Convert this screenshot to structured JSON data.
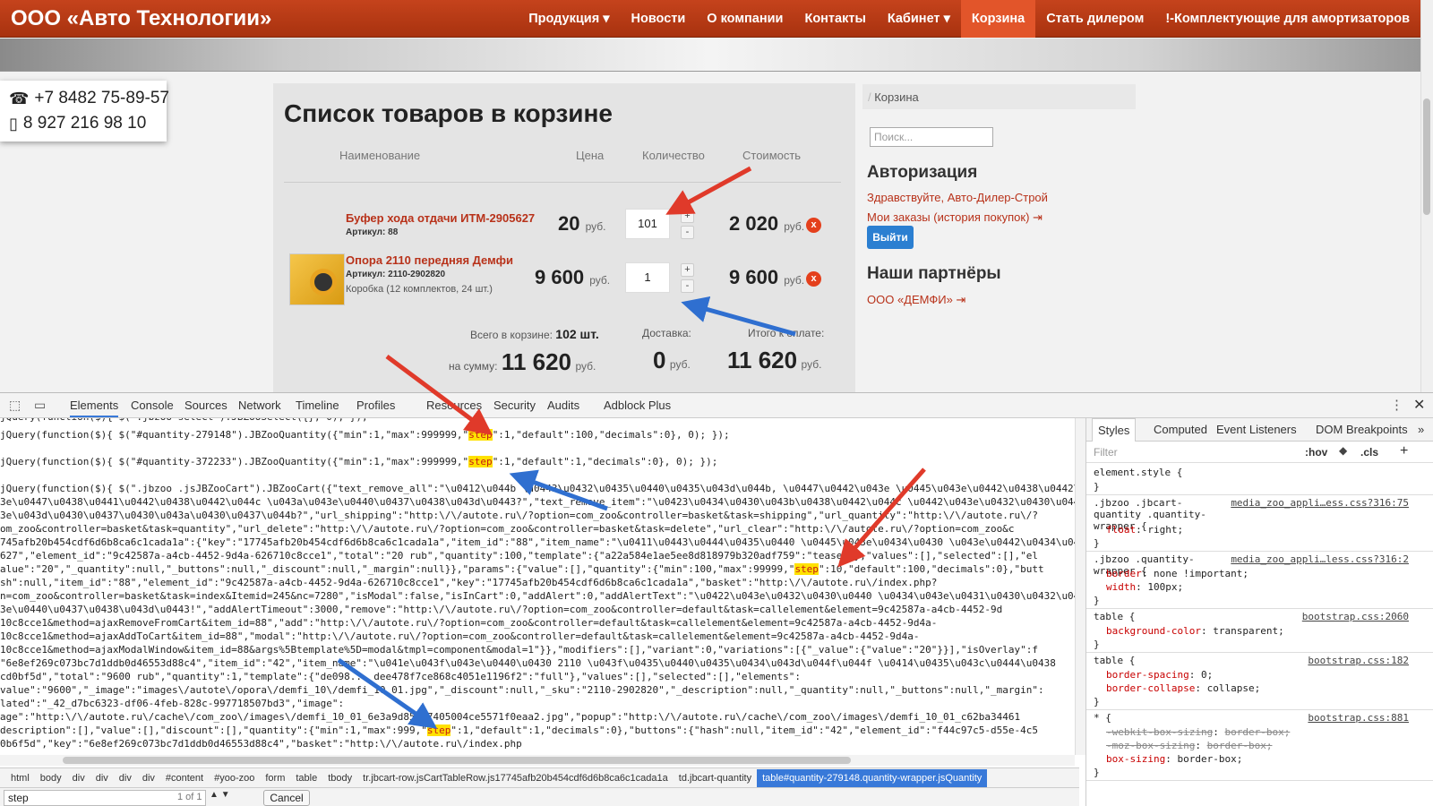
{
  "site": {
    "brand": "ООО «Авто Технологии»",
    "nav": [
      {
        "label": "Продукция",
        "caret": true
      },
      {
        "label": "Новости"
      },
      {
        "label": "О компании"
      },
      {
        "label": "Контакты"
      },
      {
        "label": "Кабинет",
        "caret": true
      },
      {
        "label": "Корзина",
        "active": true
      },
      {
        "label": "Стать дилером"
      },
      {
        "label": "!-Комплектующие для амортизаторов"
      }
    ],
    "phones": [
      "+7 8482 75-89-57",
      "8 927 216 98 10"
    ]
  },
  "cart": {
    "title": "Список товаров в корзине",
    "headers": {
      "name": "Наименование",
      "price": "Цена",
      "qty": "Количество",
      "cost": "Стоимость"
    },
    "items": [
      {
        "name": "Буфер хода отдачи ИТМ-2905627",
        "article": "Артикул: 88",
        "box": "",
        "price": "20",
        "qty": "101",
        "cost": "2 020"
      },
      {
        "name": "Опора 2110 передняя Демфи",
        "article": "Артикул: 2110-2902820",
        "box": "Коробка (12 комплектов, 24 шт.)",
        "price": "9 600",
        "qty": "1",
        "cost": "9 600"
      }
    ],
    "currency": "руб.",
    "total_count_label": "Всего в корзине:",
    "total_count": "102 шт.",
    "sum_label": "на сумму:",
    "sum": "11 620",
    "delivery_label": "Доставка:",
    "delivery": "0",
    "pay_label": "Итого к оплате:",
    "pay": "11 620",
    "plus": "+",
    "minus": "-",
    "remove": "x"
  },
  "sidebar": {
    "breadcrumb": "Корзина",
    "search_placeholder": "Поиск...",
    "auth_title": "Авторизация",
    "greeting": "Здравствуйте, Авто-Дилер-Строй",
    "orders_link": "Мои заказы (история покупок)",
    "logout": "Выйти",
    "partners_title": "Наши партнёры",
    "partner": "ООО «ДЕМФИ»"
  },
  "devtools": {
    "tabs": [
      "Elements",
      "Console",
      "Sources",
      "Network",
      "Timeline",
      "Profiles",
      "Resources",
      "Security",
      "Audits",
      "Adblock Plus"
    ],
    "code_lines": [
      {
        "pre": "jQuery(function($){ $(\".jbzoo-select\").JBZooSelect({}, 0); });",
        "hl": "",
        "post": ""
      },
      {
        "pre": "jQuery(function($){ $(\"#quantity-279148\").JBZooQuantity({\"min\":1,\"max\":999999,\"",
        "hl": "step",
        "post": "\":1,\"default\":100,\"decimals\":0}, 0); });"
      },
      {
        "pre": "jQuery(function($){ $(\"#quantity-372233\").JBZooQuantity({\"min\":1,\"max\":999999,\"",
        "hl": "step",
        "post": "\":1,\"default\":1,\"decimals\":0}, 0); });"
      },
      {
        "pre": "jQuery(function($){ $(\".jbzoo .jsJBZooCart\").JBZooCart({\"text_remove_all\":\"\\u0412\\u044b \\u0443\\u0432\\u0435\\u0440\\u0435\\u043d\\u044b, \\u0447\\u0442\\u043e \\u0445\\u043e\\u0442\\u0438\\u0442\\u0435 \\u043e\\u0447\\u0438\\u0441\\u0442\\u0438\\u0442\\u044c \\u043a\\u043e\\u0440\\u0437\\u0438\\u043d\\u0443",
        "hl": "",
        "post": ""
      },
      {
        "pre": "3e\\u0447\\u0438\\u0441\\u0442\\u0438\\u0442\\u044c \\u043a\\u043e\\u0440\\u0437\\u0438\\u043d\\u0443?\",\"text_remove_item\":\"\\u0423\\u0434\\u0430\\u043b\\u0438\\u0442\\u044c \\u0442\\u043e\\u0432\\u0430\\u0440?\"",
        "hl": "",
        "post": ""
      },
      {
        "pre": "3e\\u043d\\u0430\\u0437\\u0430\\u043a\\u0430\\u0437\\u044b?\",\"url_shipping\":\"http:\\/\\/autote.ru\\/?option=com_zoo&controller=basket&task=shipping\",\"url_quantity\":\"http:\\/\\/autote.ru\\/?",
        "hl": "",
        "post": ""
      },
      {
        "pre": "om_zoo&controller=basket&task=quantity\",\"url_delete\":\"http:\\/\\/autote.ru\\/?option=com_zoo&controller=basket&task=delete\",\"url_clear\":\"http:\\/\\/autote.ru\\/?option=com_zoo&c",
        "hl": "",
        "post": ""
      },
      {
        "pre": "745afb20b454cdf6d6b8ca6c1cada1a\":{\"key\":\"17745afb20b454cdf6d6b8ca6c1cada1a\",\"item_id\":\"88\",\"item_name\":\"\\u0411\\u0443\\u0444\\u0435\\u0440 \\u0445\\u043e\\u0434\\u0430 \\u043e\\u0442\\u0434\\u0430",
        "hl": "",
        "post": ""
      },
      {
        "pre": "627\",\"element_id\":\"9c42587a-a4cb-4452-9d4a-626710c8cce1\",\"total\":\"20 rub\",\"quantity\":100,\"template\":{\"a22a584e1ae5ee8d818979b320adf759\":\"teaser\"},\"values\":[],\"selected\":[],\"el",
        "hl": "",
        "post": ""
      },
      {
        "pre": "alue\":\"20\",\"_quantity\":null,\"_buttons\":null,\"_discount\":null,\"_margin\":null}},\"params\":{\"value\":[],\"quantity\":{\"min\":100,\"max\":99999,\"",
        "hl": "step",
        "post": "\":10,\"default\":100,\"decimals\":0},\"butt"
      },
      {
        "pre": "sh\":null,\"item_id\":\"88\",\"element_id\":\"9c42587a-a4cb-4452-9d4a-626710c8cce1\",\"key\":\"17745afb20b454cdf6d6b8ca6c1cada1a\",\"basket\":\"http:\\/\\/autote.ru\\/index.php?",
        "hl": "",
        "post": ""
      },
      {
        "pre": "n=com_zoo&controller=basket&task=index&Itemid=245&nc=7280\",\"isModal\":false,\"isInCart\":0,\"addAlert\":0,\"addAlertText\":\"\\u0422\\u043e\\u0432\\u0430\\u0440 \\u0434\\u043e\\u0431\\u0430\\u0432\\u043b\\u0435\\u043d \\u0432 \\u043a",
        "hl": "",
        "post": ""
      },
      {
        "pre": "3e\\u0440\\u0437\\u0438\\u043d\\u0443!\",\"addAlertTimeout\":3000,\"remove\":\"http:\\/\\/autote.ru\\/?option=com_zoo&controller=default&task=callelement&element=9c42587a-a4cb-4452-9d",
        "hl": "",
        "post": ""
      },
      {
        "pre": "10c8cce1&method=ajaxRemoveFromCart&item_id=88\",\"add\":\"http:\\/\\/autote.ru\\/?option=com_zoo&controller=default&task=callelement&element=9c42587a-a4cb-4452-9d4a-",
        "hl": "",
        "post": ""
      },
      {
        "pre": "10c8cce1&method=ajaxAddToCart&item_id=88\",\"modal\":\"http:\\/\\/autote.ru\\/?option=com_zoo&controller=default&task=callelement&element=9c42587a-a4cb-4452-9d4a-",
        "hl": "",
        "post": ""
      },
      {
        "pre": "10c8cce1&method=ajaxModalWindow&item_id=88&args%5Btemplate%5D=modal&tmpl=component&modal=1\"}},\"modifiers\":[],\"variant\":0,\"variations\":[{\"_value\":{\"value\":\"20\"}}],\"isOverlay\":f",
        "hl": "",
        "post": ""
      },
      {
        "pre": "\"6e8ef269c073bc7d1ddb0d46553d88c4\",\"item_id\":\"42\",\"item_name\":\"\\u041e\\u043f\\u043e\\u0440\\u0430 2110 \\u043f\\u0435\\u0440\\u0435\\u0434\\u043d\\u044f\\u044f \\u0414\\u0435\\u043c\\u0444\\u0438",
        "hl": "",
        "post": ""
      },
      {
        "pre": "cd0bf5d\",\"total\":\"9600 rub\",\"quantity\":1,\"template\":{\"de098... dee478f7ce868c4051e1196f2\":\"full\"},\"values\":[],\"selected\":[],\"elements\":",
        "hl": "",
        "post": ""
      },
      {
        "pre": "value\":\"9600\",\"_image\":\"images\\/autote\\/opora\\/demfi_10\\/demfi_10_01.jpg\",\"_discount\":null,\"_sku\":\"2110-2902820\",\"_description\":null,\"_quantity\":null,\"_buttons\":null,\"_margin\":",
        "hl": "",
        "post": ""
      },
      {
        "pre": "lated\":\"_42_d7bc6323-df06-4feb-828c-997718507bd3\",\"image\":",
        "hl": "",
        "post": ""
      },
      {
        "pre": "age\":\"http:\\/\\/autote.ru\\/cache\\/com_zoo\\/images\\/demfi_10_01_6e3a9d85ad7405004ce5571f0eaa2.jpg\",\"popup\":\"http:\\/\\/autote.ru\\/cache\\/com_zoo\\/images\\/demfi_10_01_c62ba34461",
        "hl": "",
        "post": ""
      },
      {
        "pre": "description\":[],\"value\":[],\"discount\":[],\"quantity\":{\"min\":1,\"max\":999,\"",
        "hl": "step",
        "post": "\":1,\"default\":1,\"decimals\":0},\"buttons\":{\"hash\":null,\"item_id\":\"42\",\"element_id\":\"f44c97c5-d55e-4c5"
      },
      {
        "pre": "0b6f5d\",\"key\":\"6e8ef269c073bc7d1ddb0d46553d88c4\",\"basket\":\"http:\\/\\/autote.ru\\/index.php",
        "hl": "",
        "post": ""
      }
    ],
    "breadcrumbs": [
      "html",
      "body",
      "div",
      "div",
      "div",
      "div",
      "#content",
      "#yoo-zoo",
      "form",
      "table",
      "tbody",
      "tr.jbcart-row.jsCartTableRow.js17745afb20b454cdf6d6b8ca6c1cada1a",
      "td.jbcart-quantity",
      "table#quantity-279148.quantity-wrapper.jsQuantity"
    ],
    "find_value": "step",
    "find_count": "1 of 1",
    "cancel": "Cancel",
    "styles_tabs": [
      "Styles",
      "Computed",
      "Event Listeners",
      "DOM Breakpoints",
      "»"
    ],
    "filter_placeholder": "Filter",
    "filter_hov": ":hov",
    "filter_cls": ".cls",
    "rules": [
      {
        "selector": "element.style {",
        "source": "",
        "props": []
      },
      {
        "selector": ".jbzoo .jbcart-quantity .quantity-wrapper {",
        "source": "media_zoo_appli…ess.css?316:75",
        "props": [
          {
            "name": "float",
            "value": "right;"
          }
        ]
      },
      {
        "selector": ".jbzoo .quantity-wrapper {",
        "source": "media_zoo_appli…less.css?316:2",
        "props": [
          {
            "name": "border",
            "value": "none !important;"
          },
          {
            "name": "width",
            "value": "100px;"
          }
        ]
      },
      {
        "selector": "table {",
        "source": "bootstrap.css:2060",
        "props": [
          {
            "name": "background-color",
            "value": "transparent;"
          }
        ]
      },
      {
        "selector": "table {",
        "source": "bootstrap.css:182",
        "props": [
          {
            "name": "border-spacing",
            "value": "0;"
          },
          {
            "name": "border-collapse",
            "value": "collapse;"
          }
        ]
      },
      {
        "selector": "* {",
        "source": "bootstrap.css:881",
        "props": [
          {
            "name": "-webkit-box-sizing",
            "value": "border-box;",
            "strike": true
          },
          {
            "name": "-moz-box-sizing",
            "value": "border-box;",
            "strike": true
          },
          {
            "name": "box-sizing",
            "value": "border-box;"
          }
        ]
      }
    ]
  },
  "colors": {
    "nav": "#b63a15",
    "accent": "#b8321a",
    "arrow_red": "#e03a2a",
    "arrow_blue": "#2f6fd0",
    "highlight": "#ffe100"
  }
}
